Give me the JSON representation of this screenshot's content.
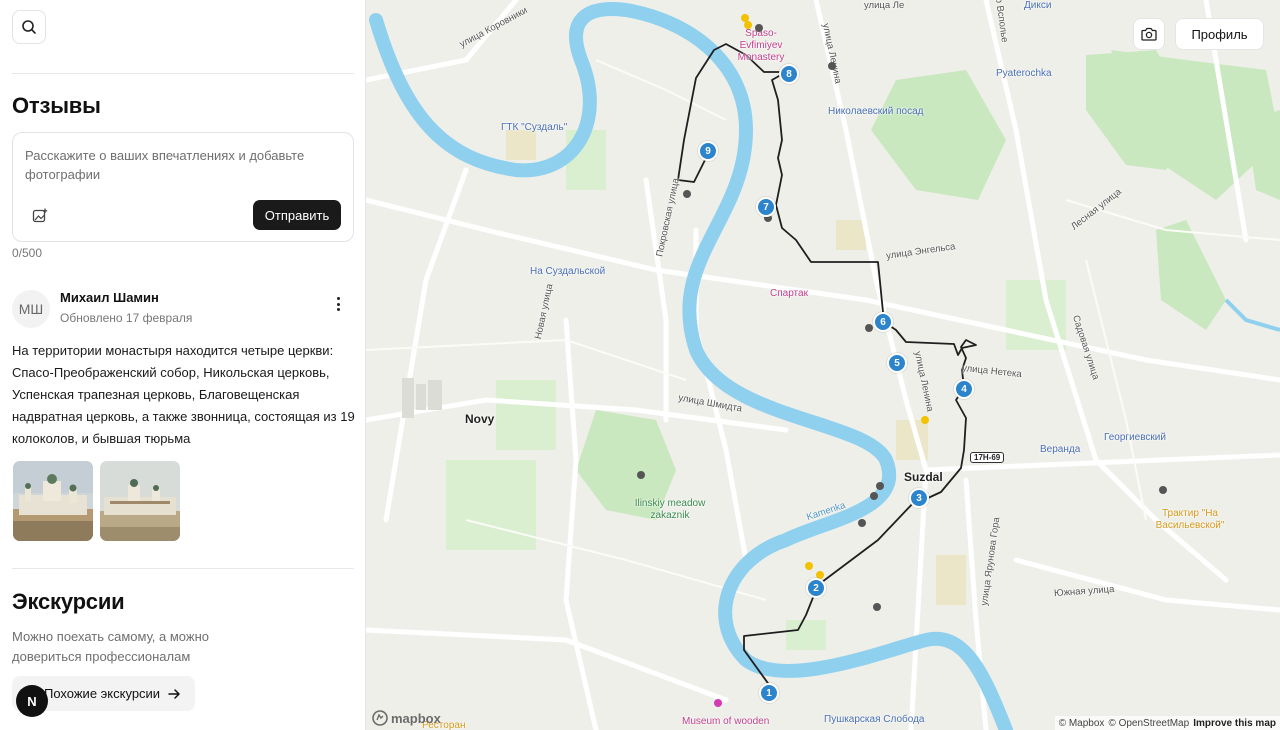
{
  "sidebar": {
    "reviews_title": "Отзывы",
    "review_input": {
      "placeholder": "Расскажите о ваших впечатлениях и добавьте фотографии",
      "send_label": "Отправить",
      "counter": "0/500"
    },
    "review": {
      "avatar_initials": "МШ",
      "author": "Михаил Шамин",
      "updated": "Обновлено 17 февраля",
      "text": "На территории монастыря находится четыре церкви: Спасо-Преображенский собор, Никольская церковь, Успенская трапезная церковь, Благовещенская надвратная церковь, а также звонница, состоящая из 19 колоколов, и бывшая тюрьма"
    },
    "excursions": {
      "title": "Экскурсии",
      "description": "Можно поехать самому, а можно довериться профессионалам",
      "button_label": "Похожие экскурсии",
      "badge": "N"
    }
  },
  "map": {
    "profile_label": "Профиль",
    "route_stops": [
      "1",
      "2",
      "3",
      "4",
      "5",
      "6",
      "7",
      "8",
      "9"
    ],
    "town_labels": {
      "suzdal": "Suzdal",
      "novy": "Novy"
    },
    "streets": {
      "korovniki": "улица Коровники",
      "lenina_top": "улица Ленина",
      "lenina_mid": "улица Ленина",
      "vspolye": "пр Всполье",
      "pokrovskaya": "Покровская улица",
      "engelsa": "улица Энгельса",
      "lesnaya": "Лесная улица",
      "novaya": "Новая улица",
      "shmidta": "улица Шмидта",
      "neteka": "улица Нетека",
      "sadovaya": "Садовая улица",
      "yarunova": "улица Ярунова Гора",
      "yuzhnaya": "Южная улица",
      "kamenka": "Kamenka",
      "top_frag": "улица Ле",
      "dixy": "Дикси"
    },
    "pois": {
      "monastery": "Spaso-Evfimiyev Monastery",
      "gtk": "ГТК \"Суздаль\"",
      "pyaterochka": "Pyaterochka",
      "nikolaevsky": "Николаевский посад",
      "na_suzdalskoy": "На Суздальской",
      "spartak": "Спартак",
      "ilinsky": "Ilinskiy meadow zakaznik",
      "veranda": "Веранда",
      "georgievsky": "Георгиевский",
      "traktir": "Трактир \"На Васильевской\"",
      "museum": "Museum of wooden",
      "pushkarskaya": "Пушкарская Слобода",
      "restoran": "Ресторан"
    },
    "road_shield": "17Н-69",
    "logo": "mapbox",
    "attribution": {
      "mapbox": "© Mapbox",
      "osm": "© OpenStreetMap",
      "improve": "Improve this map"
    },
    "colors": {
      "route_pin": "#2c84cc",
      "water": "#8fd0ef",
      "park": "#c9e8bf",
      "route_line": "#1f1f1f"
    }
  }
}
